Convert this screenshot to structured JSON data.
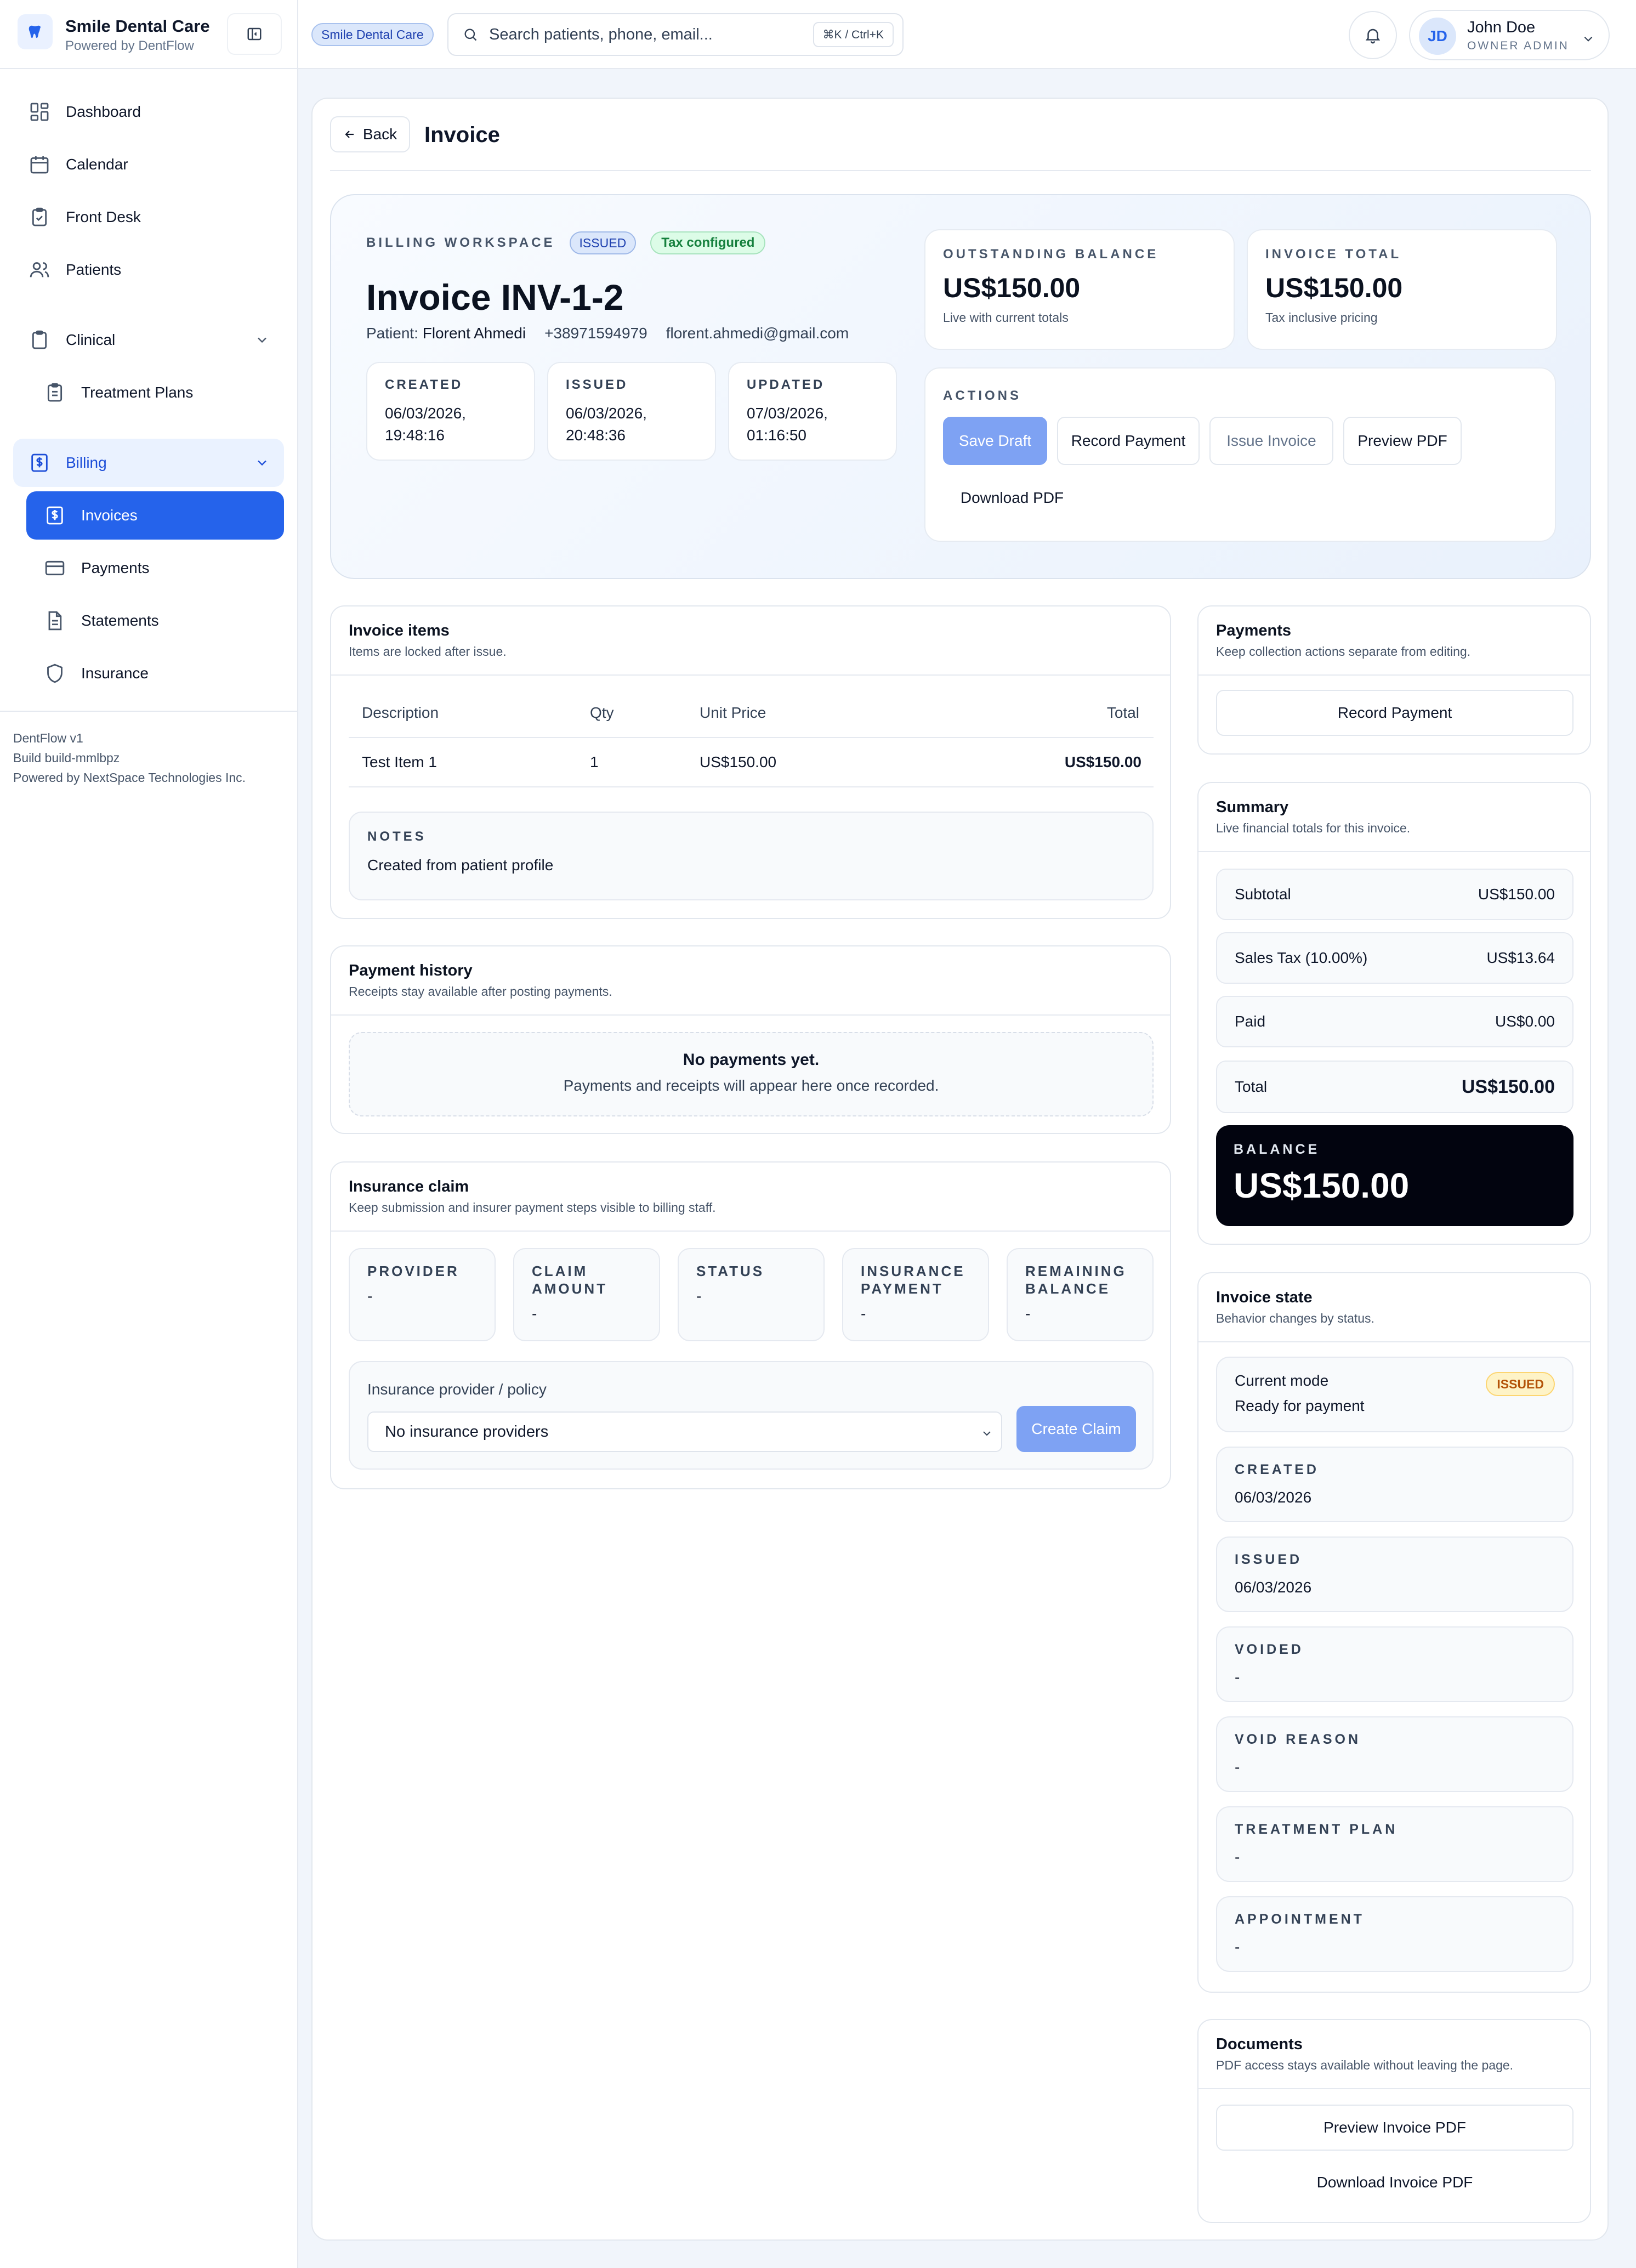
{
  "sidebar": {
    "brand_name": "Smile Dental Care",
    "brand_sub": "Powered by DentFlow",
    "nav": {
      "dashboard": "Dashboard",
      "calendar": "Calendar",
      "front_desk": "Front Desk",
      "patients": "Patients",
      "clinical": "Clinical",
      "treatment_plans": "Treatment Plans",
      "billing": "Billing",
      "invoices": "Invoices",
      "payments": "Payments",
      "statements": "Statements",
      "insurance": "Insurance"
    },
    "footer": {
      "version": "DentFlow v1",
      "build": "Build build-mmlbpz",
      "powered": "Powered by NextSpace Technologies Inc."
    }
  },
  "topbar": {
    "clinic": "Smile Dental Care",
    "search_placeholder": "Search patients, phone, email...",
    "shortcut": "⌘K / Ctrl+K",
    "user_initials": "JD",
    "user_name": "John Doe",
    "user_role": "OWNER ADMIN"
  },
  "header": {
    "back_label": "Back",
    "title": "Invoice"
  },
  "hero": {
    "eyebrow": "BILLING WORKSPACE",
    "status_pill": "ISSUED",
    "tax_pill": "Tax configured",
    "invoice_number": "Invoice INV-1-2",
    "patient_prefix": "Patient:",
    "patient_name": "Florent Ahmedi",
    "phone": "+38971594979",
    "email": "florent.ahmedi@gmail.com",
    "created_label": "CREATED",
    "created_value": "06/03/2026, 19:48:16",
    "issued_label": "ISSUED",
    "issued_value": "06/03/2026, 20:48:36",
    "updated_label": "UPDATED",
    "updated_value": "07/03/2026, 01:16:50",
    "outstanding_label": "OUTSTANDING BALANCE",
    "outstanding_value": "US$150.00",
    "outstanding_hint": "Live with current totals",
    "total_label": "INVOICE TOTAL",
    "total_value": "US$150.00",
    "total_hint": "Tax inclusive pricing",
    "actions_label": "ACTIONS",
    "actions": {
      "save_draft": "Save Draft",
      "record_payment": "Record Payment",
      "issue_invoice": "Issue Invoice",
      "preview_pdf": "Preview PDF",
      "download_pdf": "Download PDF"
    }
  },
  "items": {
    "title": "Invoice items",
    "subtitle": "Items are locked after issue.",
    "columns": [
      "Description",
      "Qty",
      "Unit Price",
      "Total"
    ],
    "rows": [
      {
        "description": "Test Item 1",
        "qty": "1",
        "unit_price": "US$150.00",
        "total": "US$150.00"
      }
    ],
    "notes_label": "NOTES",
    "notes_value": "Created from patient profile"
  },
  "payment_history": {
    "title": "Payment history",
    "subtitle": "Receipts stay available after posting payments.",
    "empty_title": "No payments yet.",
    "empty_text": "Payments and receipts will appear here once recorded."
  },
  "insurance": {
    "title": "Insurance claim",
    "subtitle": "Keep submission and insurer payment steps visible to billing staff.",
    "boxes": [
      {
        "label": "PROVIDER",
        "value": "-"
      },
      {
        "label": "CLAIM AMOUNT",
        "value": "-"
      },
      {
        "label": "STATUS",
        "value": "-"
      },
      {
        "label": "INSURANCE PAYMENT",
        "value": "-"
      },
      {
        "label": "REMAINING BALANCE",
        "value": "-"
      }
    ],
    "policy_label": "Insurance provider / policy",
    "policy_selected": "No insurance providers",
    "create_claim": "Create Claim"
  },
  "payments_card": {
    "title": "Payments",
    "subtitle": "Keep collection actions separate from editing.",
    "record_payment": "Record Payment"
  },
  "summary": {
    "title": "Summary",
    "subtitle": "Live financial totals for this invoice.",
    "subtotal_label": "Subtotal",
    "subtotal_value": "US$150.00",
    "tax_label": "Sales Tax (10.00%)",
    "tax_value": "US$13.64",
    "paid_label": "Paid",
    "paid_value": "US$0.00",
    "total_label": "Total",
    "total_value": "US$150.00",
    "balance_label": "BALANCE",
    "balance_value": "US$150.00"
  },
  "invoice_state": {
    "title": "Invoice state",
    "subtitle": "Behavior changes by status.",
    "mode_label": "Current mode",
    "mode_value": "Ready for payment",
    "mode_pill": "ISSUED",
    "fields": [
      {
        "label": "CREATED",
        "value": "06/03/2026"
      },
      {
        "label": "ISSUED",
        "value": "06/03/2026"
      },
      {
        "label": "VOIDED",
        "value": "-"
      },
      {
        "label": "VOID REASON",
        "value": "-"
      },
      {
        "label": "TREATMENT PLAN",
        "value": "-"
      },
      {
        "label": "APPOINTMENT",
        "value": "-"
      }
    ]
  },
  "documents": {
    "title": "Documents",
    "subtitle": "PDF access stays available without leaving the page.",
    "preview": "Preview Invoice PDF",
    "download": "Download Invoice PDF"
  },
  "colors": {
    "accent": "#2563eb",
    "accent_soft": "#eaf2ff",
    "balance_bg": "#02040f",
    "success": "#15803d",
    "warning": "#b45309"
  }
}
